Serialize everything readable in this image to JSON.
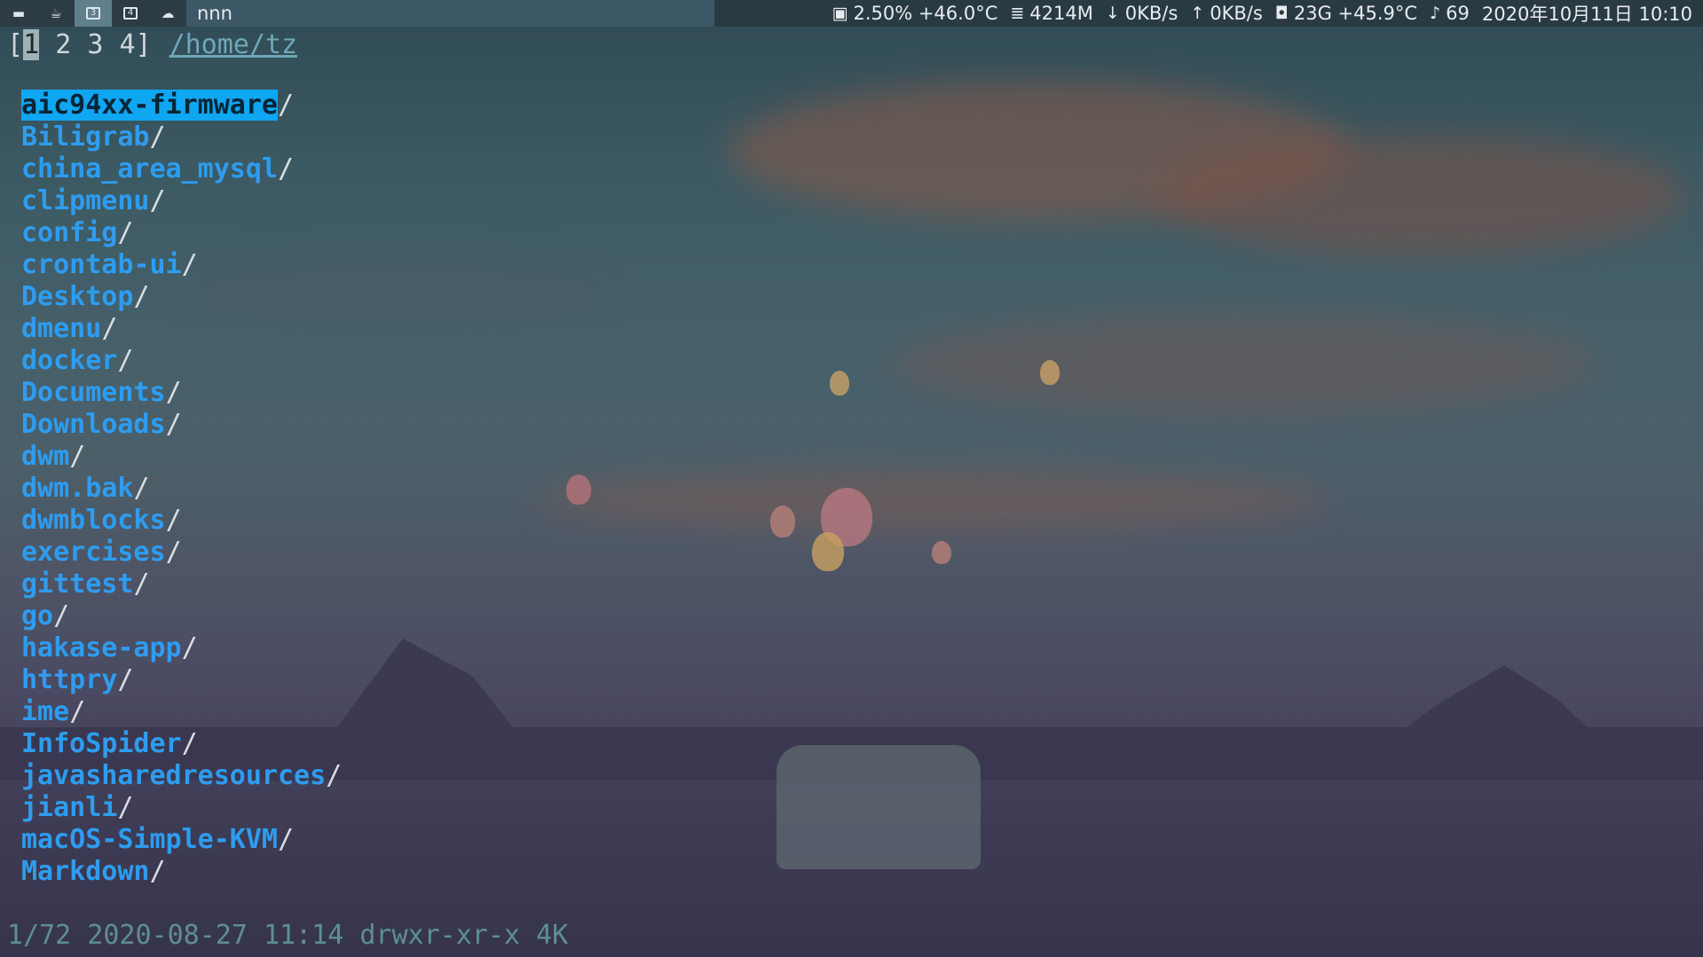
{
  "topbar": {
    "tags": [
      {
        "icon": "terminal-icon",
        "glyph": "▬"
      },
      {
        "icon": "coffee-icon",
        "glyph": "☕"
      },
      {
        "icon": "tag-3-icon",
        "glyph": "3"
      },
      {
        "icon": "tag-4-icon",
        "glyph": "4"
      },
      {
        "icon": "cloud-icon",
        "glyph": "☁"
      }
    ],
    "active_tag_index": 2,
    "window_title": "nnn",
    "status": {
      "cpu": "2.50% +46.0°C",
      "mem": "4214M",
      "down": "0KB/s",
      "up": "0KB/s",
      "disk": "23G +45.9°C",
      "notifications": "69",
      "datetime": "2020年10月11日 10:10"
    }
  },
  "nnn": {
    "contexts": [
      "1",
      "2",
      "3",
      "4"
    ],
    "active_context": "1",
    "path": "/home/tz",
    "entries": [
      "aic94xx-firmware",
      "Biligrab",
      "china_area_mysql",
      "clipmenu",
      "config",
      "crontab-ui",
      "Desktop",
      "dmenu",
      "docker",
      "Documents",
      "Downloads",
      "dwm",
      "dwm.bak",
      "dwmblocks",
      "exercises",
      "gittest",
      "go",
      "hakase-app",
      "httpry",
      "ime",
      "InfoSpider",
      "javasharedresources",
      "jianli",
      "macOS-Simple-KVM",
      "Markdown"
    ],
    "selected_index": 0,
    "dir_suffix": "/",
    "statusline": "1/72 2020-08-27 11:14 drwxr-xr-x 4K"
  },
  "colors": {
    "dir": "#2e9cef",
    "selection": "#0fa6f2",
    "statusline": "#5d8f91",
    "bar": "#2c3b44"
  }
}
